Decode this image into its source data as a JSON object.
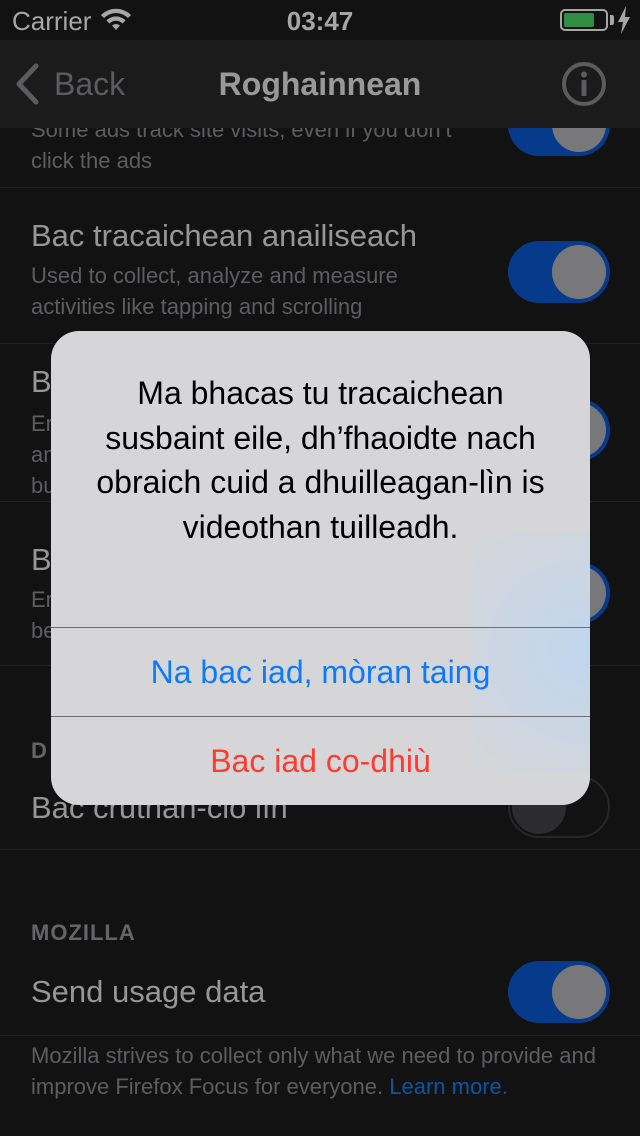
{
  "status_bar": {
    "carrier": "Carrier",
    "time": "03:47",
    "battery_level": 0.75
  },
  "navbar": {
    "back_label": "Back",
    "title": "Roghainnean",
    "info_icon": "info-circle-icon"
  },
  "settings": {
    "row0": {
      "desc": "Some ads track site visits, even if you don’t click the ads",
      "toggle_on": true
    },
    "row1": {
      "title": "Bac tracaichean anailiseach",
      "desc": "Used to collect, analyze and measure activities like tapping and scrolling",
      "toggle_on": true
    },
    "row2": {
      "title": "B",
      "desc": "Er an bu",
      "toggle_on": true
    },
    "row3": {
      "title": "B",
      "desc": "Er be",
      "toggle_on": true
    },
    "section_d": {
      "header": "D"
    },
    "row4": {
      "title": "Bac crutnan-clo lìn",
      "toggle_on": false
    },
    "section_mozilla": {
      "header": "MOZILLA"
    },
    "row5": {
      "title": "Send usage data",
      "toggle_on": true
    },
    "footer": {
      "text": "Mozilla strives to collect only what we need to provide and improve Firefox Focus for everyone.",
      "learn_more": "Learn more."
    }
  },
  "alert": {
    "message": "Ma bhacas tu tracaichean susbaint eile, dh’fhaoidte nach obraich cuid a dhuilleagan-lìn is videothan tuilleadh.",
    "cancel_label": "Na bac iad, mòran taing",
    "confirm_label": "Bac iad co-dhiù"
  },
  "colors": {
    "accent": "#0a84ff",
    "toggle_on": "#0a5bd6",
    "destructive": "#ff3b30"
  }
}
